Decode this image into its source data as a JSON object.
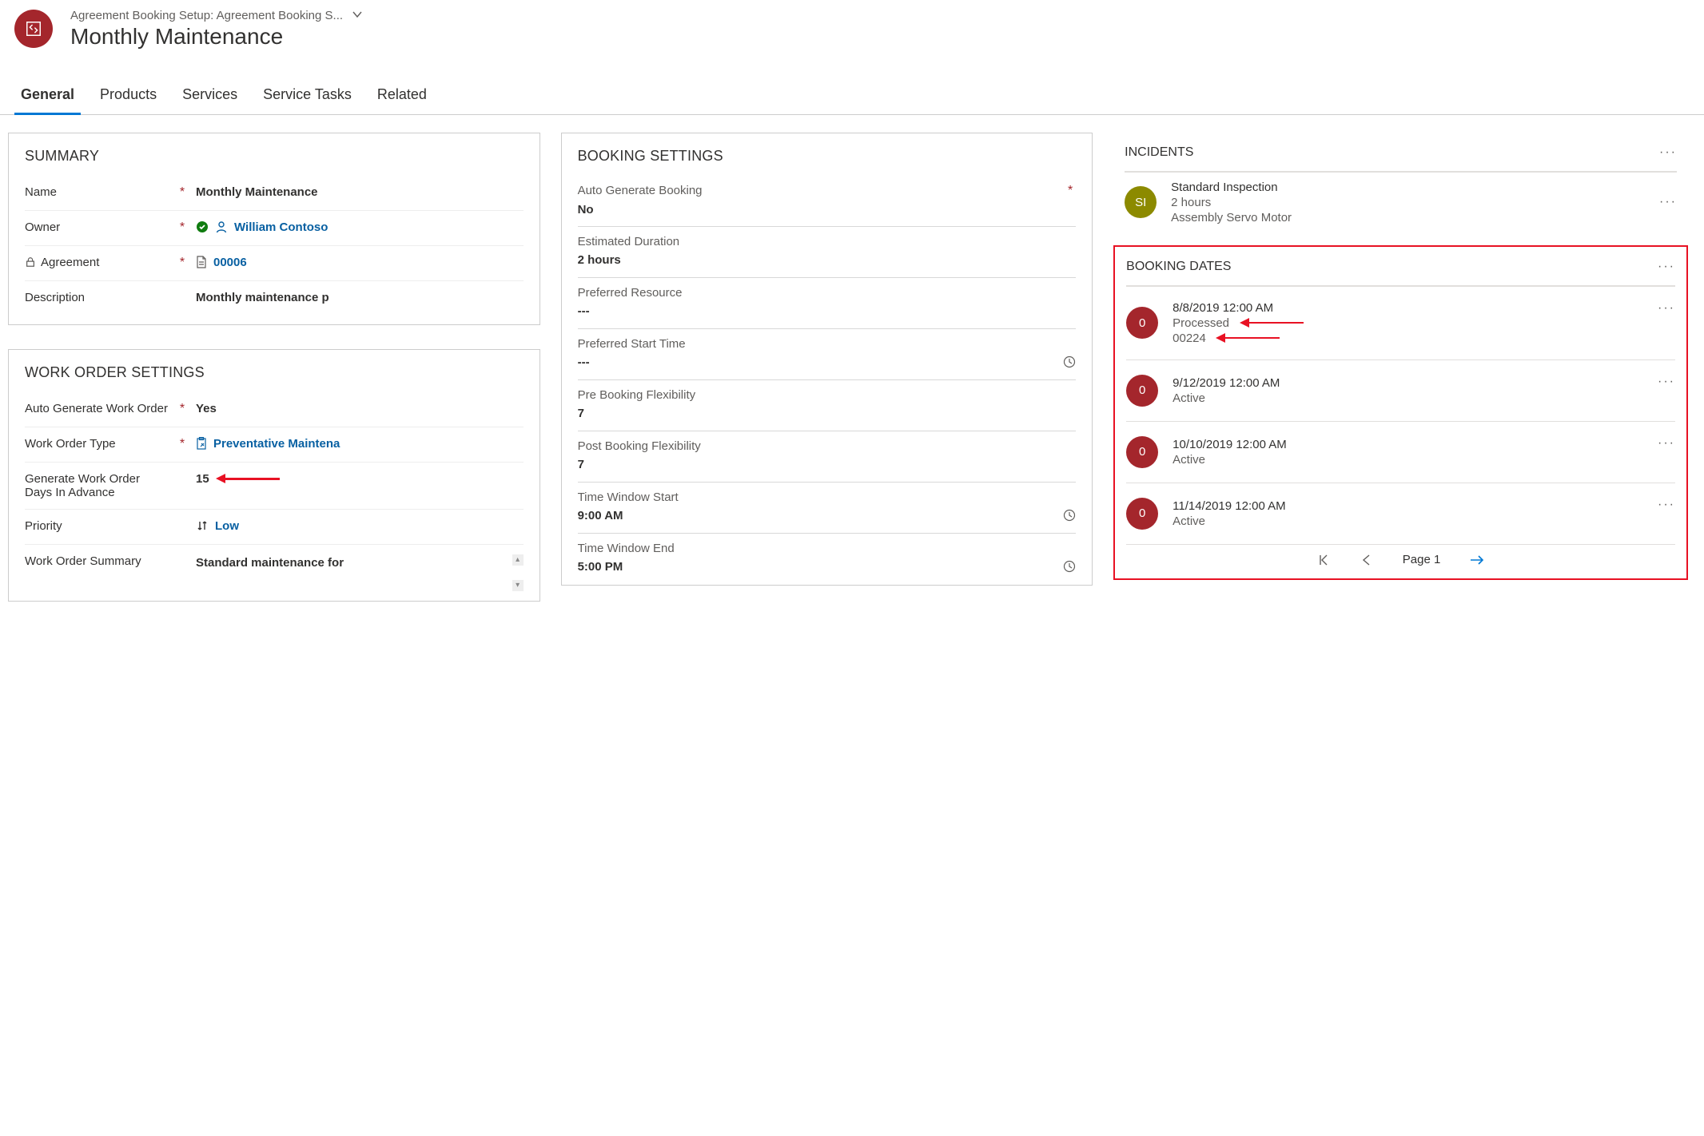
{
  "header": {
    "breadcrumb": "Agreement Booking Setup: Agreement Booking S...",
    "title": "Monthly Maintenance"
  },
  "tabs": [
    "General",
    "Products",
    "Services",
    "Service Tasks",
    "Related"
  ],
  "active_tab": 0,
  "summary": {
    "title": "SUMMARY",
    "name_label": "Name",
    "name_value": "Monthly Maintenance",
    "owner_label": "Owner",
    "owner_value": "William Contoso",
    "agreement_label": "Agreement",
    "agreement_value": "00006",
    "description_label": "Description",
    "description_value": "Monthly maintenance p"
  },
  "work_order": {
    "title": "WORK ORDER SETTINGS",
    "auto_label": "Auto Generate Work Order",
    "auto_value": "Yes",
    "type_label": "Work Order Type",
    "type_value": "Preventative Maintena",
    "days_label": "Generate Work Order Days In Advance",
    "days_value": "15",
    "priority_label": "Priority",
    "priority_value": "Low",
    "summary_label": "Work Order Summary",
    "summary_value": "Standard maintenance for"
  },
  "booking_settings": {
    "title": "BOOKING SETTINGS",
    "auto_label": "Auto Generate Booking",
    "auto_value": "No",
    "duration_label": "Estimated Duration",
    "duration_value": "2 hours",
    "resource_label": "Preferred Resource",
    "resource_value": "---",
    "start_label": "Preferred Start Time",
    "start_value": "---",
    "preflex_label": "Pre Booking Flexibility",
    "preflex_value": "7",
    "postflex_label": "Post Booking Flexibility",
    "postflex_value": "7",
    "winstart_label": "Time Window Start",
    "winstart_value": "9:00 AM",
    "winend_label": "Time Window End",
    "winend_value": "5:00 PM"
  },
  "incidents": {
    "title": "INCIDENTS",
    "items": [
      {
        "initials": "SI",
        "line1": "Standard Inspection",
        "line2": "2 hours",
        "line3": "Assembly Servo Motor"
      }
    ]
  },
  "booking_dates": {
    "title": "BOOKING DATES",
    "items": [
      {
        "badge": "0",
        "line1": "8/8/2019 12:00 AM",
        "line2": "Processed",
        "line3": "00224",
        "annotated": true
      },
      {
        "badge": "0",
        "line1": "9/12/2019 12:00 AM",
        "line2": "Active"
      },
      {
        "badge": "0",
        "line1": "10/10/2019 12:00 AM",
        "line2": "Active"
      },
      {
        "badge": "0",
        "line1": "11/14/2019 12:00 AM",
        "line2": "Active"
      }
    ],
    "page_label": "Page 1"
  }
}
